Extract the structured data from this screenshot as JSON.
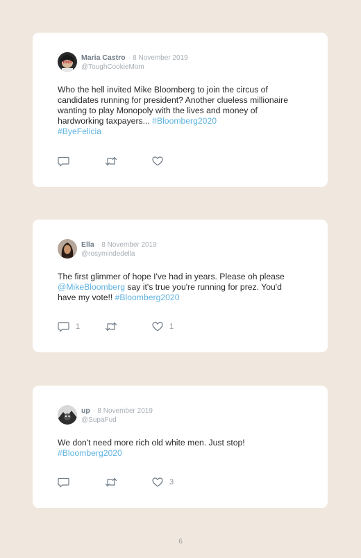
{
  "tweets": [
    {
      "name": "Maria Castro",
      "date": "· 8 November 2019",
      "handle": "@ToughCookieMom",
      "text_1": "Who the hell invited Mike Bloomberg to join the circus of candidates running for president? Another clueless millionaire wanting to play Monopoly with the lives and money of hardworking taxpayers... ",
      "hashtag_1": "#Bloomberg2020",
      "hashtag_2": "#ByeFelicia",
      "replies": "",
      "retweets": "",
      "likes": ""
    },
    {
      "name": "Ella",
      "date": "· 8 November 2019",
      "handle": "@rosymindedella",
      "text_1": "The first glimmer of hope I've had in years. Please oh please ",
      "mention": "@MikeBloomberg",
      "text_2": " say it's true you're running for prez. You'd have my vote!! ",
      "hashtag_1": "#Bloomberg2020",
      "replies": "1",
      "retweets": "",
      "likes": "1"
    },
    {
      "name": "up",
      "date": "· 8 November 2019",
      "handle": "@SupaFud",
      "text_1": "We don't need more rich old white men. Just stop! ",
      "hashtag_1": "#Bloomberg2020",
      "replies": "",
      "retweets": "",
      "likes": "3"
    }
  ],
  "page": {
    "number": "6"
  },
  "colors": {
    "background": "#f0e8de",
    "card": "#ffffff",
    "link": "#5fb3e0",
    "icon": "#6f7b86"
  },
  "icons": [
    "reply-icon",
    "retweet-icon",
    "like-icon"
  ]
}
